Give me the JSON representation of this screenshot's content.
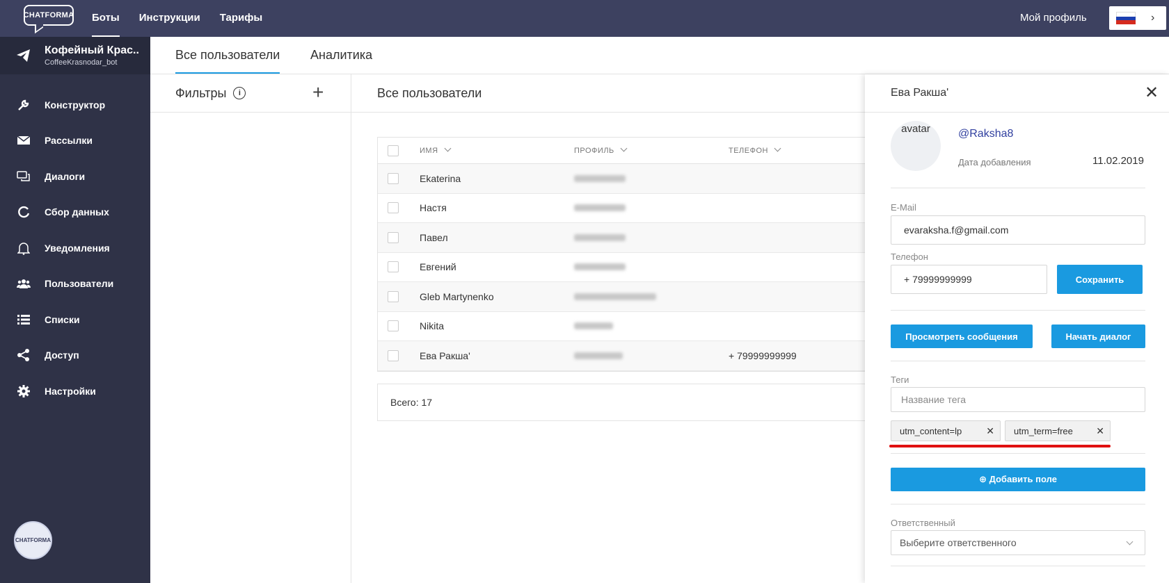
{
  "topbar": {
    "logo_text": "CHATFORMA",
    "nav": [
      "Боты",
      "Инструкции",
      "Тарифы"
    ],
    "profile_label": "Мой профиль",
    "lang_chevron": "›",
    "flag_colors": [
      "#ffffff",
      "#1c3fb0",
      "#d52b1e"
    ]
  },
  "sidebar": {
    "bot_name": "Кофейный Крас...",
    "bot_handle": "CoffeeKrasnodar_bot",
    "items": [
      {
        "label": "Конструктор",
        "icon": "wrench-icon"
      },
      {
        "label": "Рассылки",
        "icon": "mail-icon"
      },
      {
        "label": "Диалоги",
        "icon": "chat-icon"
      },
      {
        "label": "Сбор данных",
        "icon": "refresh-icon"
      },
      {
        "label": "Уведомления",
        "icon": "bell-icon"
      },
      {
        "label": "Пользователи",
        "icon": "users-icon"
      },
      {
        "label": "Списки",
        "icon": "list-icon"
      },
      {
        "label": "Доступ",
        "icon": "share-icon"
      },
      {
        "label": "Настройки",
        "icon": "gear-icon"
      }
    ],
    "avatar_text": "CHATFORMA"
  },
  "tabs": {
    "all_users": "Все пользователи",
    "analytics": "Аналитика"
  },
  "filters": {
    "title": "Фильтры",
    "info": "i",
    "add": "+"
  },
  "main": {
    "title": "Все пользователи",
    "columns": {
      "name": "ИМЯ",
      "profile": "ПРОФИЛЬ",
      "phone": "ТЕЛЕФОН"
    },
    "rows": [
      {
        "name": "Ekaterina",
        "phone": ""
      },
      {
        "name": "Настя",
        "phone": ""
      },
      {
        "name": "Павел",
        "phone": ""
      },
      {
        "name": "Евгений",
        "phone": ""
      },
      {
        "name": "Gleb Martynenko",
        "phone": ""
      },
      {
        "name": "Nikita",
        "phone": ""
      },
      {
        "name": "Ева Ракша'",
        "phone": "+ 79999999999"
      }
    ],
    "total": "Всего: 17"
  },
  "panel": {
    "title": "Ева Ракша'",
    "close": "✕",
    "avatar_alt": "avatar",
    "username": "@Raksha8",
    "date_label": "Дата добавления",
    "date_value": "11.02.2019",
    "email_label": "E-Mail",
    "email_value": "evaraksha.f@gmail.com",
    "phone_label": "Телефон",
    "phone_value": "+ 79999999999",
    "save_btn": "Сохранить",
    "view_messages_btn": "Просмотреть сообщения",
    "start_dialog_btn": "Начать диалог",
    "tags_label": "Теги",
    "tag_placeholder": "Название тега",
    "tags": [
      "utm_content=lp",
      "utm_term=free"
    ],
    "tag_remove": "✕",
    "add_field_btn": "⊕ Добавить поле",
    "responsible_label": "Ответственный",
    "responsible_placeholder": "Выберите ответственного",
    "accent_color": "#1a9ae0",
    "highlight_color": "#e01010"
  }
}
